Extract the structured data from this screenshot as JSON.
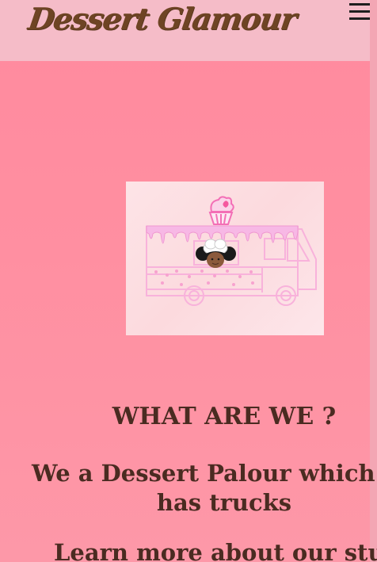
{
  "header": {
    "brand": "Dessert Glamour",
    "menu_icon": "hamburger-menu-icon"
  },
  "hero": {
    "image": "pink-dessert-food-truck-illustration"
  },
  "main": {
    "title": "WHAT ARE WE ?",
    "tagline_line1": "We a Dessert Palour which als",
    "tagline_line2": "has trucks",
    "learn_more": "Learn more about our stunnin"
  },
  "colors": {
    "page_background": "#ff8ea1",
    "header_background": "#f5bcc8",
    "brand_text": "#6e4424",
    "body_text": "#4a2b21",
    "truck_outline": "#f8a9d4"
  }
}
